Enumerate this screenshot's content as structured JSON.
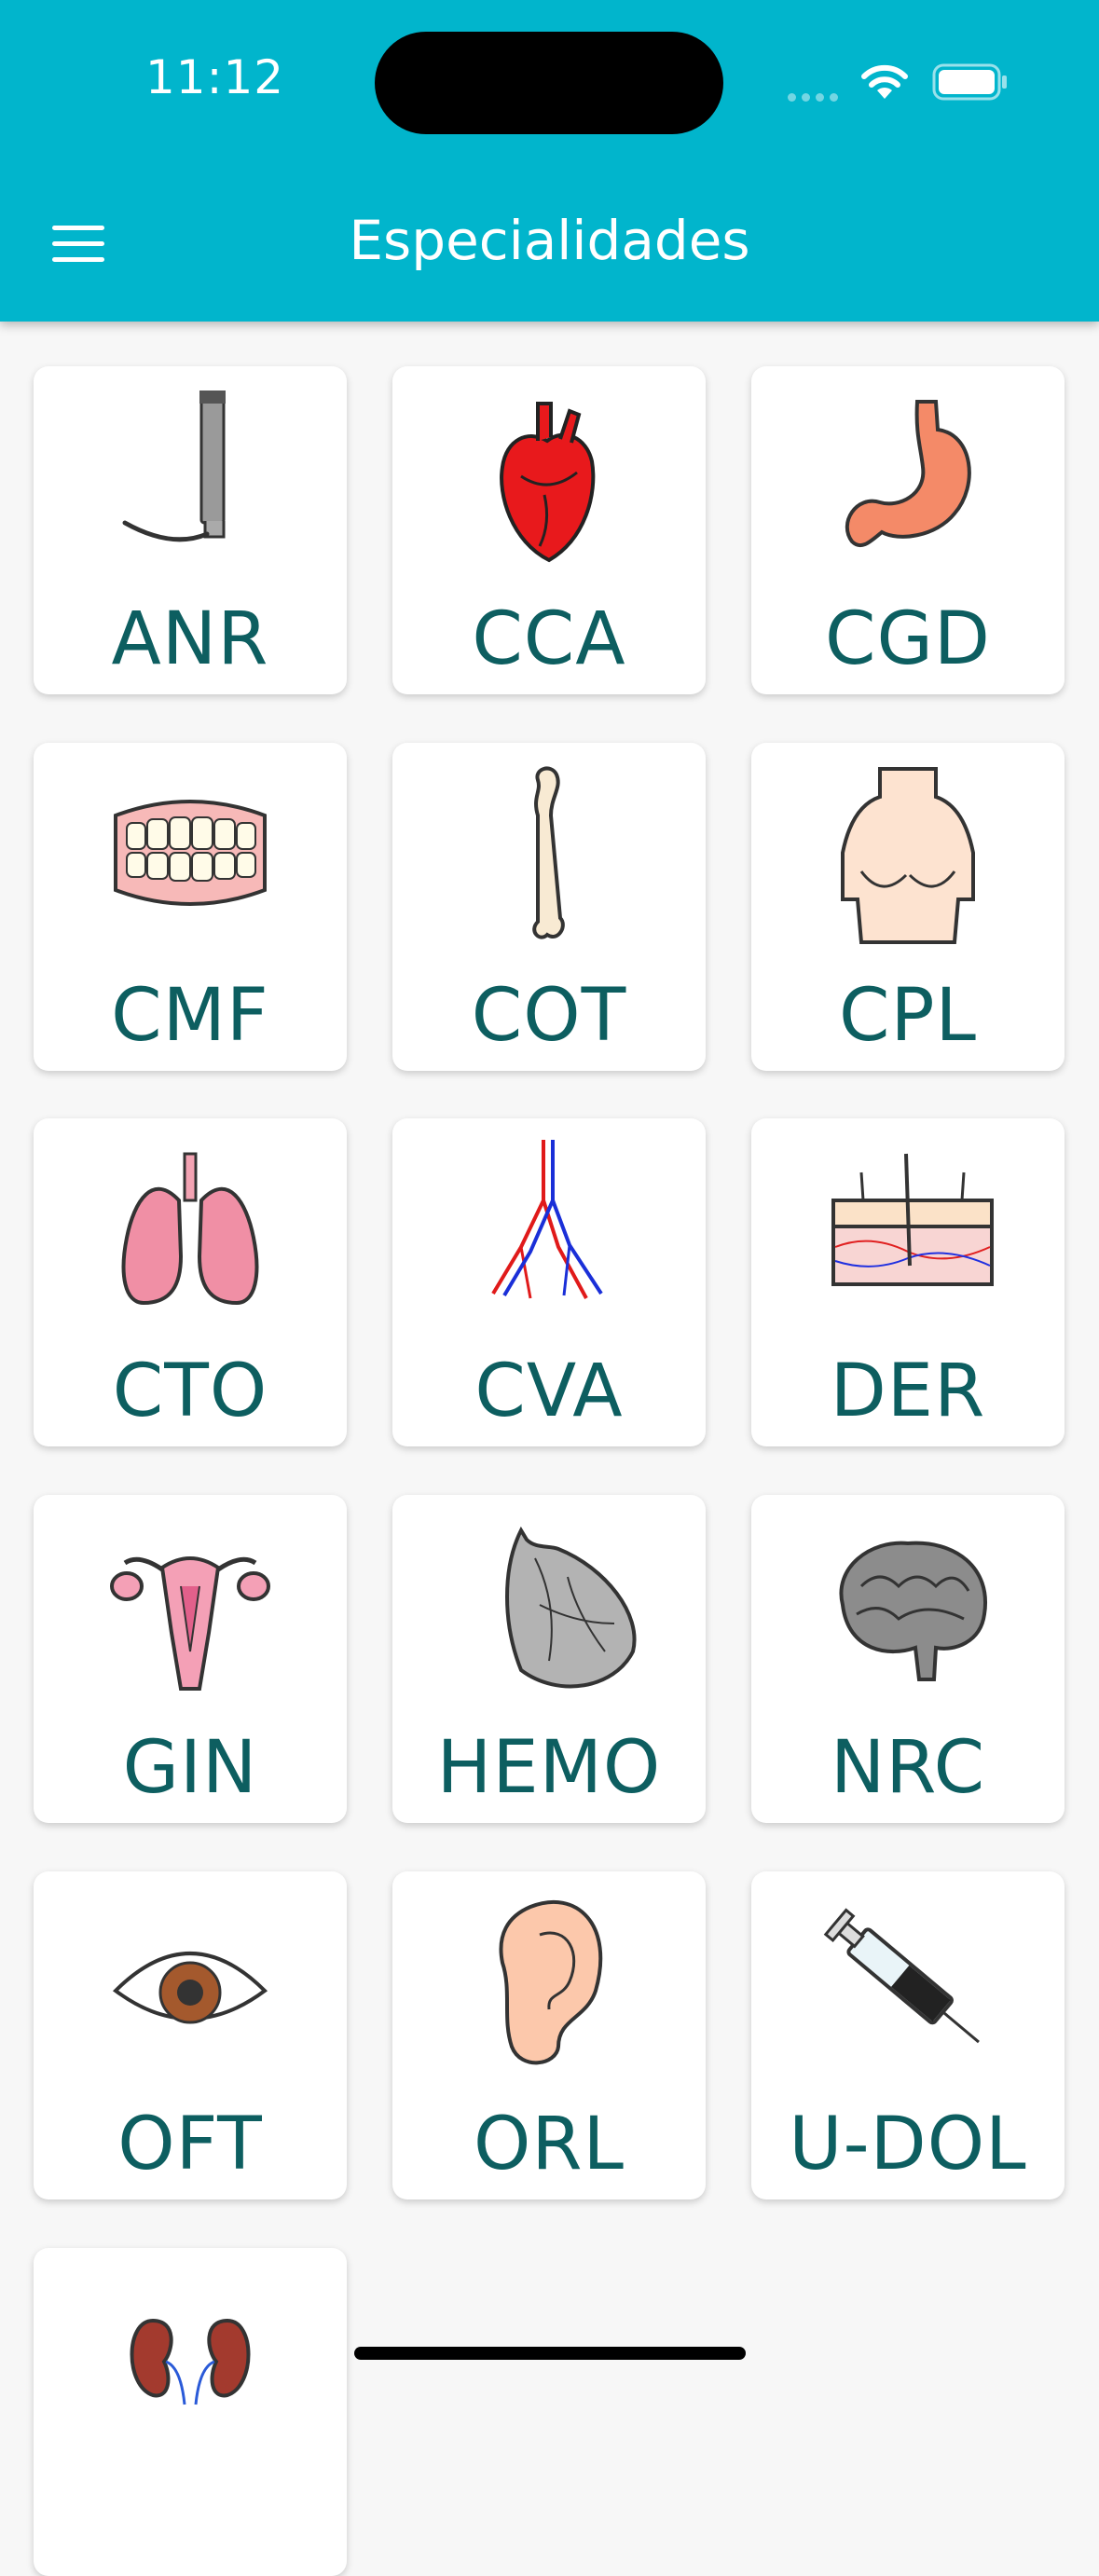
{
  "status_bar": {
    "time": "11:12"
  },
  "header": {
    "title": "Especialidades"
  },
  "colors": {
    "header_bg": "#01b5cc",
    "label_color": "#0d5e60",
    "background": "#f7f7f7"
  },
  "specialties": [
    {
      "label": "ANR",
      "icon": "laryngoscope-icon"
    },
    {
      "label": "CCA",
      "icon": "heart-icon"
    },
    {
      "label": "CGD",
      "icon": "stomach-icon"
    },
    {
      "label": "CMF",
      "icon": "dentures-icon"
    },
    {
      "label": "COT",
      "icon": "femur-bone-icon"
    },
    {
      "label": "CPL",
      "icon": "torso-icon"
    },
    {
      "label": "CTO",
      "icon": "lungs-icon"
    },
    {
      "label": "CVA",
      "icon": "blood-vessels-icon"
    },
    {
      "label": "DER",
      "icon": "skin-layer-icon"
    },
    {
      "label": "GIN",
      "icon": "uterus-icon"
    },
    {
      "label": "HEMO",
      "icon": "hemodynamics-heart-icon"
    },
    {
      "label": "NRC",
      "icon": "brain-icon"
    },
    {
      "label": "OFT",
      "icon": "eye-icon"
    },
    {
      "label": "ORL",
      "icon": "ear-icon"
    },
    {
      "label": "U-DOL",
      "icon": "syringe-icon"
    },
    {
      "label": "",
      "icon": "kidneys-icon"
    }
  ]
}
